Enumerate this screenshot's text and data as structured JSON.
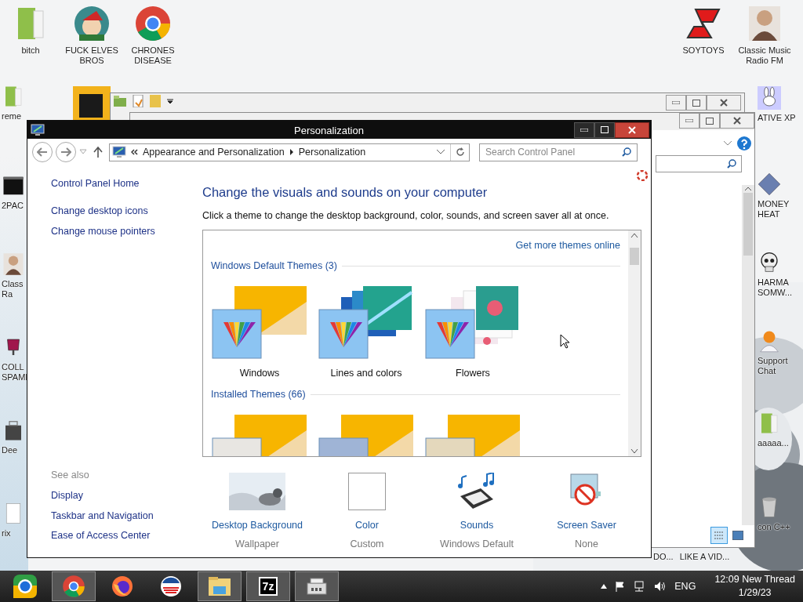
{
  "desktop_icons": [
    {
      "label": "bitch",
      "kind": "folder"
    },
    {
      "label": "FUCK ELVES BROS",
      "kind": "ornament"
    },
    {
      "label": "CHRONES DISEASE",
      "kind": "chrome"
    },
    {
      "label": "SOYTOYS",
      "kind": "logo"
    },
    {
      "label": "Classic Music Radio FM",
      "kind": "portrait"
    }
  ],
  "left_edge_icons": [
    {
      "label": "reme",
      "kind": "folder"
    },
    {
      "label": "2PAC",
      "kind": "terminal"
    },
    {
      "label": "Class Ra",
      "kind": "portrait"
    },
    {
      "label": "COLL SPAMI",
      "kind": "glass"
    },
    {
      "label": "Dee",
      "kind": "bag"
    },
    {
      "label": "rix",
      "kind": "document"
    }
  ],
  "right_edge_icons": [
    {
      "label": "ATIVE XP",
      "kind": "bunny"
    },
    {
      "label": "MONEY HEAT",
      "kind": "diamond"
    },
    {
      "label": "HARMA SOMW...",
      "kind": "skull"
    },
    {
      "label": "Support Chat",
      "kind": "person"
    },
    {
      "label": "aaaaa...",
      "kind": "folder"
    },
    {
      "label": "con C++",
      "kind": "trash"
    }
  ],
  "bottom_labels": [
    "DO...",
    "LIKE A VID..."
  ],
  "window": {
    "title": "Personalization",
    "breadcrumb": [
      "Appearance and Personalization",
      "Personalization"
    ],
    "search_placeholder": "Search Control Panel",
    "left_links": [
      "Control Panel Home",
      "Change desktop icons",
      "Change mouse pointers"
    ],
    "see_also": {
      "title": "See also",
      "links": [
        "Display",
        "Taskbar and Navigation",
        "Ease of Access Center"
      ]
    },
    "heading": "Change the visuals and sounds on your computer",
    "description": "Click a theme to change the desktop background, color, sounds, and screen saver all at once.",
    "more_themes_link": "Get more themes online",
    "theme_groups": [
      {
        "title": "Windows Default Themes (3)",
        "themes": [
          {
            "name": "Windows",
            "kind": "yellow",
            "color": "#8cc4f2"
          },
          {
            "name": "Lines and colors",
            "kind": "lines",
            "color": "#8cc4f2"
          },
          {
            "name": "Flowers",
            "kind": "flowers",
            "color": "#8cc4f2"
          }
        ]
      },
      {
        "title": "Installed Themes (66)",
        "themes": [
          {
            "kind": "yellow",
            "color": "#e8e6e2"
          },
          {
            "kind": "yellow",
            "color": "#9fb4d6"
          },
          {
            "kind": "yellow",
            "color": "#e4d8bc"
          }
        ]
      }
    ],
    "settings": [
      {
        "label": "Desktop Background",
        "value": "Wallpaper",
        "kind": "wallpaper"
      },
      {
        "label": "Color",
        "value": "Custom",
        "kind": "color"
      },
      {
        "label": "Sounds",
        "value": "Windows Default",
        "kind": "sounds"
      },
      {
        "label": "Screen Saver",
        "value": "None",
        "kind": "screensaver"
      }
    ]
  },
  "taskbar": {
    "apps": [
      {
        "kind": "start",
        "running": false
      },
      {
        "kind": "chrome",
        "running": true
      },
      {
        "kind": "firefox",
        "running": false
      },
      {
        "kind": "campaign",
        "running": false
      },
      {
        "kind": "explorer",
        "running": true
      },
      {
        "kind": "sevenzip",
        "text": "7z",
        "running": true
      },
      {
        "kind": "archive",
        "running": true
      }
    ],
    "language": "ENG",
    "time": "12:09 New Thread",
    "date": "1/29/23"
  }
}
